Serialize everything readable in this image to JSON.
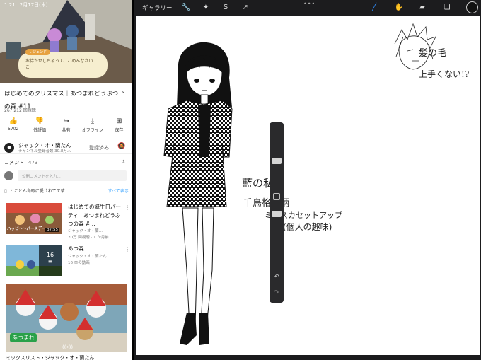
{
  "status": {
    "time": "1:21",
    "date": "2月17日(木)"
  },
  "video": {
    "dialog_name": "レジェンド",
    "dialog_text": "お待たせしちゃって、ごめんなさい\nこ",
    "title": "はじめてのクリスマス｜あつまれどうぶつの森 #11",
    "views": "267,212 回視聴"
  },
  "actions": [
    {
      "icon": "like-icon",
      "glyph": "👍",
      "label": "5702"
    },
    {
      "icon": "dislike-icon",
      "glyph": "👎",
      "label": "低評価"
    },
    {
      "icon": "share-icon",
      "glyph": "↪",
      "label": "共有"
    },
    {
      "icon": "download-icon",
      "glyph": "⤓",
      "label": "オフライン"
    },
    {
      "icon": "save-icon",
      "glyph": "⊞",
      "label": "保存"
    }
  ],
  "channel": {
    "name": "ジャック・オ・蘭たん",
    "subs": "チャンネル登録者数 30.8万人",
    "subscribed": "登録済み"
  },
  "comments": {
    "label": "コメント",
    "count": "473",
    "placeholder": "公開コメントを入力..."
  },
  "playlist": {
    "text": "とことん島暇に愛されてて草",
    "all": "すべて表示"
  },
  "recs": [
    {
      "title": "はじめての誕生日パーティ｜あつまれどうぶつの森 #…",
      "meta1": "ジャック・オ・蘭…",
      "meta2": "20万 回視聴 · 1 か月前",
      "duration": "37:55",
      "banner": "ハッピ〜〜パースデー"
    },
    {
      "title": "あつ森",
      "meta1": "ジャック・オ・蘭たん",
      "meta2": "16 本の動画",
      "count": "16"
    }
  ],
  "big_rec": {
    "caption": "ミックスリスト・ジャック・オ・蘭たん",
    "logo": "あつまれ"
  },
  "drawing": {
    "gallery": "ギャラリー",
    "note_hair": "髪の毛",
    "note_hair2": "上手くない!?",
    "note1": "藍の私服",
    "note2": "千鳥格子柄",
    "note3": "ミニスカセットアップ",
    "note4": "(個人の趣味)"
  },
  "colors": {
    "accent": "#3ea6ff",
    "brush": "#2f8fff"
  }
}
